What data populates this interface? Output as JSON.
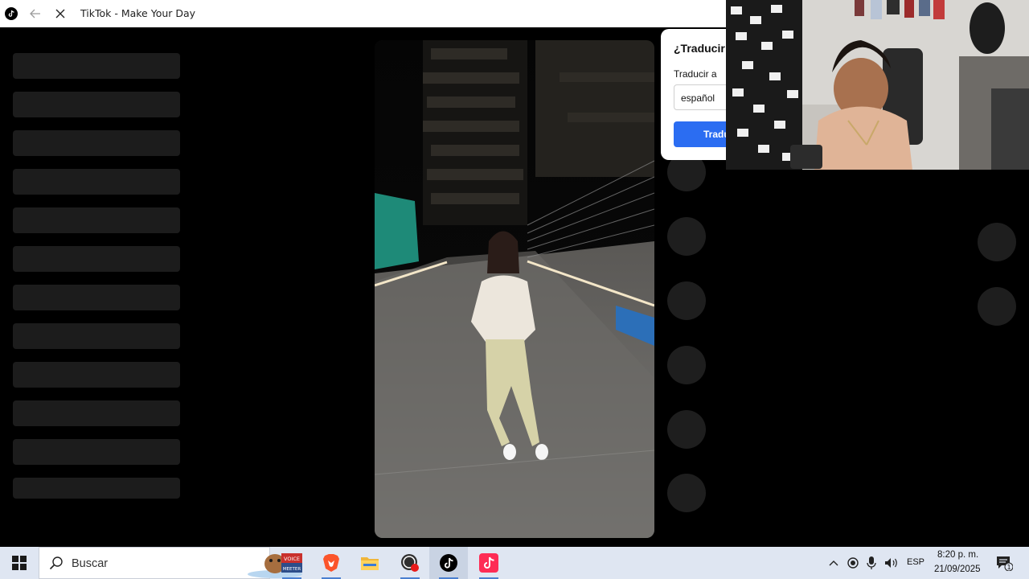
{
  "window": {
    "title": "TikTok - Make Your Day"
  },
  "translate_popup": {
    "title": "¿Traducir",
    "label": "Traducir a",
    "selected_language": "español",
    "button_label": "Tradu"
  },
  "taskbar": {
    "search_placeholder": "Buscar",
    "apps": [
      "voicemeeter-icon",
      "brave-icon",
      "file-explorer-icon",
      "obs-icon",
      "tiktok-icon",
      "tiktok-app-icon"
    ],
    "voicemeeter_text_top": "VOICE",
    "voicemeeter_text_bottom": "MEETER",
    "language": "ESP",
    "time": "8:20 p. m.",
    "date": "21/09/2025",
    "notification_count": "1"
  },
  "colors": {
    "accent_blue": "#2b6df2",
    "tiktok_pink": "#fe2c55",
    "skeleton": "#1c1c1c"
  }
}
